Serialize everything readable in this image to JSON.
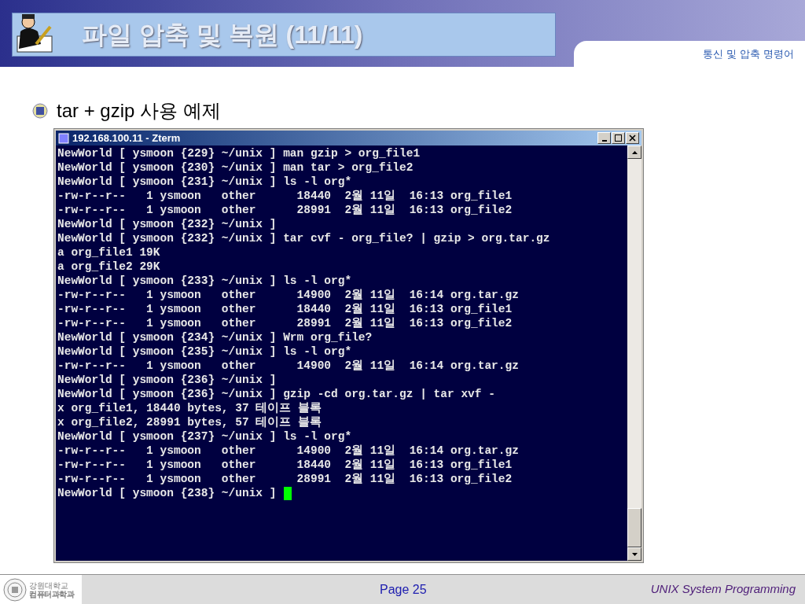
{
  "header": {
    "title": "파일 압축 및 복원 (11/11)",
    "section": "통신 및 압축 명령어"
  },
  "bullet": {
    "text": "tar + gzip 사용 예제"
  },
  "terminal": {
    "title": "192.168.100.11 - Zterm",
    "lines": [
      "NewWorld [ ysmoon {229} ~/unix ] man gzip > org_file1",
      "NewWorld [ ysmoon {230} ~/unix ] man tar > org_file2",
      "NewWorld [ ysmoon {231} ~/unix ] ls -l org*",
      "-rw-r--r--   1 ysmoon   other      18440  2월 11일  16:13 org_file1",
      "-rw-r--r--   1 ysmoon   other      28991  2월 11일  16:13 org_file2",
      "NewWorld [ ysmoon {232} ~/unix ]",
      "NewWorld [ ysmoon {232} ~/unix ] tar cvf - org_file? | gzip > org.tar.gz",
      "a org_file1 19K",
      "a org_file2 29K",
      "NewWorld [ ysmoon {233} ~/unix ] ls -l org*",
      "-rw-r--r--   1 ysmoon   other      14900  2월 11일  16:14 org.tar.gz",
      "-rw-r--r--   1 ysmoon   other      18440  2월 11일  16:13 org_file1",
      "-rw-r--r--   1 ysmoon   other      28991  2월 11일  16:13 org_file2",
      "NewWorld [ ysmoon {234} ~/unix ] Wrm org_file?",
      "NewWorld [ ysmoon {235} ~/unix ] ls -l org*",
      "-rw-r--r--   1 ysmoon   other      14900  2월 11일  16:14 org.tar.gz",
      "NewWorld [ ysmoon {236} ~/unix ]",
      "NewWorld [ ysmoon {236} ~/unix ] gzip -cd org.tar.gz | tar xvf -",
      "x org_file1, 18440 bytes, 37 테이프 블록",
      "x org_file2, 28991 bytes, 57 테이프 블록",
      "NewWorld [ ysmoon {237} ~/unix ] ls -l org*",
      "-rw-r--r--   1 ysmoon   other      14900  2월 11일  16:14 org.tar.gz",
      "-rw-r--r--   1 ysmoon   other      18440  2월 11일  16:13 org_file1",
      "-rw-r--r--   1 ysmoon   other      28991  2월 11일  16:13 org_file2",
      "NewWorld [ ysmoon {238} ~/unix ]"
    ]
  },
  "footer": {
    "logo_lines": [
      "강원대학교",
      "컴퓨터과학과"
    ],
    "page": "Page 25",
    "course": "UNIX System Programming"
  }
}
